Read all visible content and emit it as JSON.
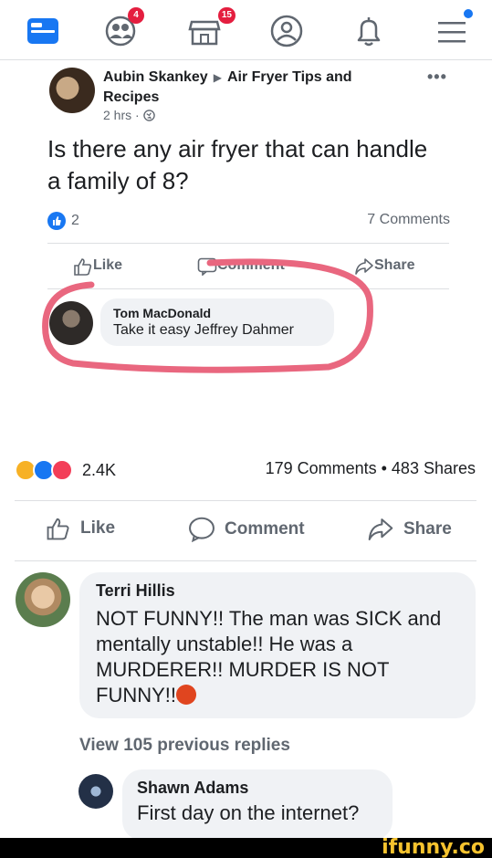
{
  "nav": {
    "items": [
      {
        "name": "home-icon"
      },
      {
        "name": "friends-icon",
        "badge": "4"
      },
      {
        "name": "marketplace-icon",
        "badge": "15"
      },
      {
        "name": "profile-icon"
      },
      {
        "name": "notifications-icon"
      },
      {
        "name": "menu-icon",
        "dot": true
      }
    ],
    "accent": "#1877f2",
    "badge_color": "#e41e3f"
  },
  "inner_post": {
    "author": "Aubin Skankey",
    "group": "Air Fryer Tips and Recipes",
    "time": "2 hrs ·",
    "text": "Is there any air fryer that can handle a family of 8?",
    "likes": "2",
    "comments": "7 Comments",
    "actions": {
      "like": "Like",
      "comment": "Comment",
      "share": "Share"
    },
    "comment": {
      "name": "Tom MacDonald",
      "text": "Take it easy Jeffrey Dahmer"
    },
    "annotation_color": "#e9677f"
  },
  "post": {
    "reaction_count": "2.4K",
    "stats": "179 Comments • 483 Shares",
    "actions": {
      "like": "Like",
      "comment": "Comment",
      "share": "Share"
    }
  },
  "comment": {
    "name": "Terri Hillis",
    "text": "NOT FUNNY!! The man was SICK and mentally unstable!! He was a MURDERER!! MURDER IS NOT FUNNY!!"
  },
  "view_previous": "View 105 previous replies",
  "reply": {
    "name": "Shawn Adams",
    "text": "First day on the internet?"
  },
  "watermark": "ifunny.co"
}
